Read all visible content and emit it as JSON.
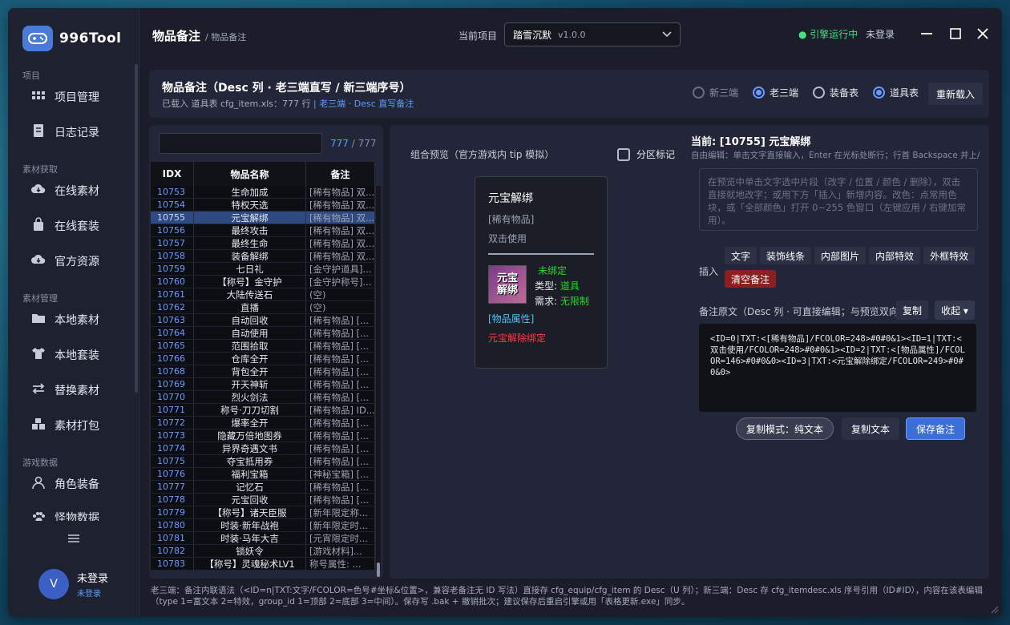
{
  "app": {
    "name": "996Tool",
    "logo_icon": "gamepad-icon"
  },
  "sidebar": {
    "sections": [
      {
        "label": "项目"
      },
      {
        "label": "素材获取"
      },
      {
        "label": "素材管理"
      },
      {
        "label": "游戏数据"
      }
    ],
    "items": [
      {
        "label": "项目管理",
        "icon": "grid-icon"
      },
      {
        "label": "日志记录",
        "icon": "document-icon"
      },
      {
        "label": "在线素材",
        "icon": "cloud-download-icon"
      },
      {
        "label": "在线套装",
        "icon": "bag-icon"
      },
      {
        "label": "官方资源",
        "icon": "cloud-download-icon"
      },
      {
        "label": "本地素材",
        "icon": "folder-icon"
      },
      {
        "label": "本地套装",
        "icon": "shirt-icon"
      },
      {
        "label": "替换素材",
        "icon": "swap-icon"
      },
      {
        "label": "素材打包",
        "icon": "package-icon"
      },
      {
        "label": "角色装备",
        "icon": "user-icon"
      },
      {
        "label": "怪物数据",
        "icon": "paw-icon"
      }
    ],
    "menu_icon": "hamburger-icon",
    "user": {
      "avatar": "V",
      "name": "未登录",
      "status": "未登录"
    }
  },
  "header": {
    "title": "物品备注",
    "breadcrumb": "/ 物品备注",
    "project_label": "当前项目",
    "project_name": "踏雪沉默",
    "project_version": "v1.0.0",
    "engine_status": "● 引擎运行中",
    "login": "未登录"
  },
  "card": {
    "title": "物品备注（Desc 列 · 老三端直写 / 新三端序号）",
    "sub": "已载入 道具表 cfg_item.xls：777 行",
    "sep": "|",
    "link": "老三端 · Desc 直写备注",
    "radios": [
      {
        "label": "新三端",
        "checked": false,
        "dim": true
      },
      {
        "label": "老三端",
        "checked": true
      },
      {
        "label": "装备表",
        "checked": false
      },
      {
        "label": "道具表",
        "checked": true
      }
    ],
    "reload": "重新载入"
  },
  "list": {
    "count": "777",
    "total": "/ 777",
    "columns": [
      "IDX",
      "物品名称",
      "备注"
    ],
    "rows": [
      [
        "10753",
        "生命加成",
        "[稀有物品] 双..."
      ],
      [
        "10754",
        "特权天选",
        "[稀有物品] 双..."
      ],
      [
        "10755",
        "元宝解绑",
        "[稀有物品] 双..."
      ],
      [
        "10756",
        "最终攻击",
        "[稀有物品] 双..."
      ],
      [
        "10757",
        "最终生命",
        "[稀有物品] 双..."
      ],
      [
        "10758",
        "装备解绑",
        "[稀有物品] 双..."
      ],
      [
        "10759",
        "七日礼",
        "[金守护道具]..."
      ],
      [
        "10760",
        "【称号】金守护",
        "[金守护称号]..."
      ],
      [
        "10761",
        "大陆传送石",
        "(空)"
      ],
      [
        "10762",
        "直播",
        "(空)"
      ],
      [
        "10763",
        "自动回收",
        "[稀有物品] [..."
      ],
      [
        "10764",
        "自动使用",
        "[稀有物品] [..."
      ],
      [
        "10765",
        "范围拾取",
        "[稀有物品] [..."
      ],
      [
        "10766",
        "仓库全开",
        "[稀有物品] [..."
      ],
      [
        "10768",
        "背包全开",
        "[稀有物品] [..."
      ],
      [
        "10769",
        "开天神斩",
        "[稀有物品] [..."
      ],
      [
        "10770",
        "烈火剑法",
        "[稀有物品] [..."
      ],
      [
        "10771",
        "称号·刀刀切割",
        "[稀有物品] ID..."
      ],
      [
        "10772",
        "爆率全开",
        "[稀有物品] [..."
      ],
      [
        "10773",
        "隐藏万倍地图券",
        "[稀有物品] [..."
      ],
      [
        "10774",
        "异界奇遇文书",
        "[稀有物品] [..."
      ],
      [
        "10775",
        "夺宝抵用券",
        "[稀有物品] [..."
      ],
      [
        "10776",
        "福利宝箱",
        "[神秘宝箱] [..."
      ],
      [
        "10777",
        "记忆石",
        "[稀有物品] [..."
      ],
      [
        "10778",
        "元宝回收",
        "[稀有物品] [..."
      ],
      [
        "10779",
        "【称号】诸天臣服",
        "[新年限定称..."
      ],
      [
        "10780",
        "时装·新年战袍",
        "[新年限定时..."
      ],
      [
        "10781",
        "时装·马年大吉",
        "[元宵限定时..."
      ],
      [
        "10782",
        "锁妖令",
        "[游戏材料]..."
      ],
      [
        "10783",
        "【称号】灵魂秘术LV1",
        "称号属性: ..."
      ]
    ],
    "selected": 2
  },
  "preview": {
    "label": "组合预览（官方游戏内 tip 模拟）",
    "zone": "分区标记",
    "tip": {
      "name": "元宝解绑",
      "rarity": "[稀有物品]",
      "usage": "双击使用",
      "icon_text1": "元宝",
      "icon_text2": "解绑",
      "bind": "未绑定",
      "type_k": "类型:",
      "type_v": "道具",
      "req_k": "需求:",
      "req_v": "无限制",
      "attr": "[物品属性]",
      "unbind": "元宝解除绑定"
    }
  },
  "editor": {
    "current": "当前: [10755] 元宝解绑",
    "hint": "自由编辑：单击文字直接输入，Enter 在光标处断行；行首 Backspace 并上/删",
    "placeholder": "在预览中单击文字选中片段（改字 / 位置 / 颜色 / 删除），双击直接就地改字；或用下方「插入」新增内容。改色：点常用色块，或「全部颜色」打开 0~255 色窗口（左键应用 / 右键加常用）。",
    "insert_label": "插入",
    "insert_btns": [
      "文字",
      "装饰线条",
      "内部图片",
      "内部特效",
      "外框特效"
    ],
    "clear": "清空备注",
    "raw_label": "备注原文（Desc 列 · 可直接编辑；与预览双向同",
    "copy": "复制",
    "collapse": "收起 ▾",
    "raw": "<ID=0|TXT:<[稀有物品]/FCOLOR=248>#0#0&1><ID=1|TXT:<双击使用/FCOLOR=248>#0#0&1><ID=2|TXT:<[物品属性]/FCOLOR=146>#0#0&0><ID=3|TXT:<元宝解除绑定/FCOLOR=249>#0#0&0>",
    "copy_mode": "复制模式：纯文本",
    "copy_text": "复制文本",
    "save": "保存备注"
  },
  "footer": "老三端：备注内联语法（<ID=n|TXT:文字/FCOLOR=色号#坐标&位置>，兼容老备注无 ID 写法）直接存 cfg_equip/cfg_item 的 Desc（U 列）；新三端：Desc 存 cfg_itemdesc.xls 序号引用（ID#ID），内容在该表编辑（type 1=富文本 2=特效，group_id 1=顶部 2=底部 3=中间）。保存写 .bak + 撤销批次；建议保存后重启引擎或用「表格更新.exe」同步。",
  "colors": {
    "accent": "#5d9cff",
    "engine": "#4ade80",
    "selected_row": "#2f4a80",
    "danger": "#8a2020"
  }
}
